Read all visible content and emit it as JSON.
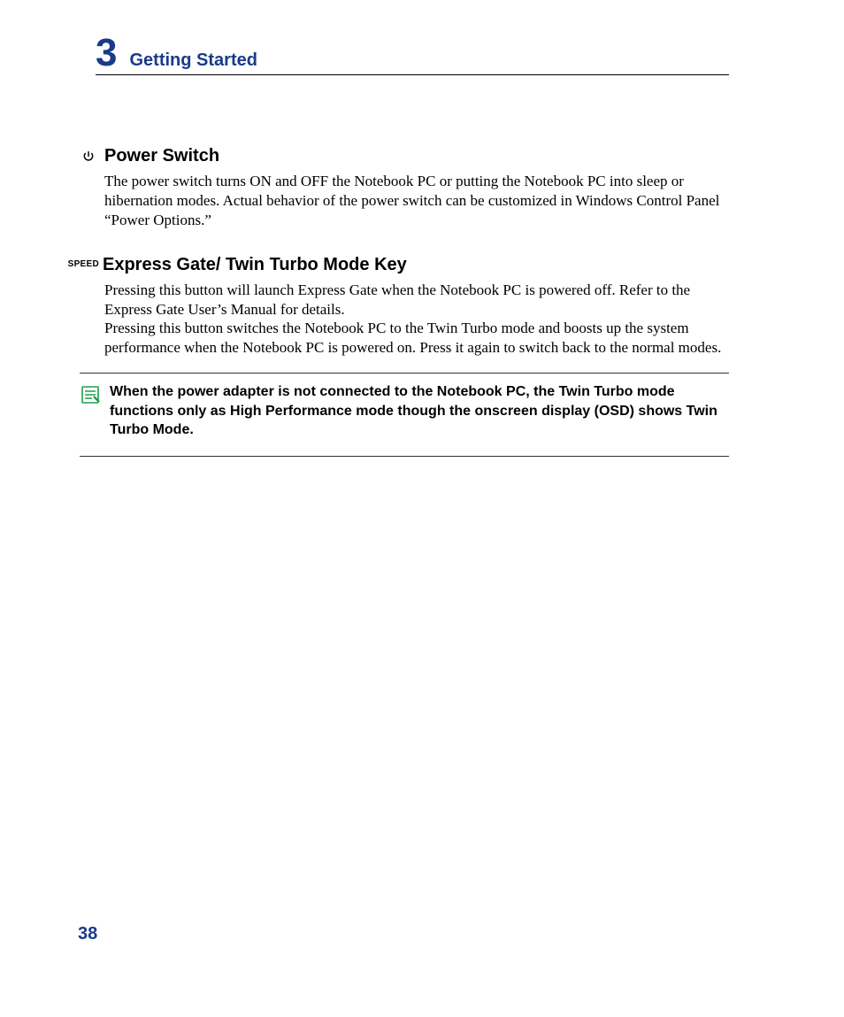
{
  "chapter": {
    "number": "3",
    "title": "Getting Started"
  },
  "sections": {
    "power": {
      "title": "Power Switch",
      "body": "The power switch turns ON and OFF the Notebook PC or putting the Notebook PC into sleep or hibernation modes. Actual behavior of the power switch can be customized in Windows Control Panel “Power Options.”"
    },
    "express": {
      "label": "SPEED",
      "title": "Express Gate/ Twin Turbo Mode Key",
      "body1": "Pressing this button will launch Express Gate when the Notebook PC is powered off. Refer to the Express Gate User’s Manual for details.",
      "body2": "Pressing this button switches the Notebook PC to the Twin Turbo mode and boosts up the system performance when the Notebook PC is powered on. Press it again to switch back to the normal modes."
    }
  },
  "note": {
    "text": "When the power adapter is not connected to the Notebook PC, the Twin Turbo mode functions only as High Performance mode though the onscreen display (OSD) shows Twin Turbo Mode."
  },
  "pageNumber": "38"
}
